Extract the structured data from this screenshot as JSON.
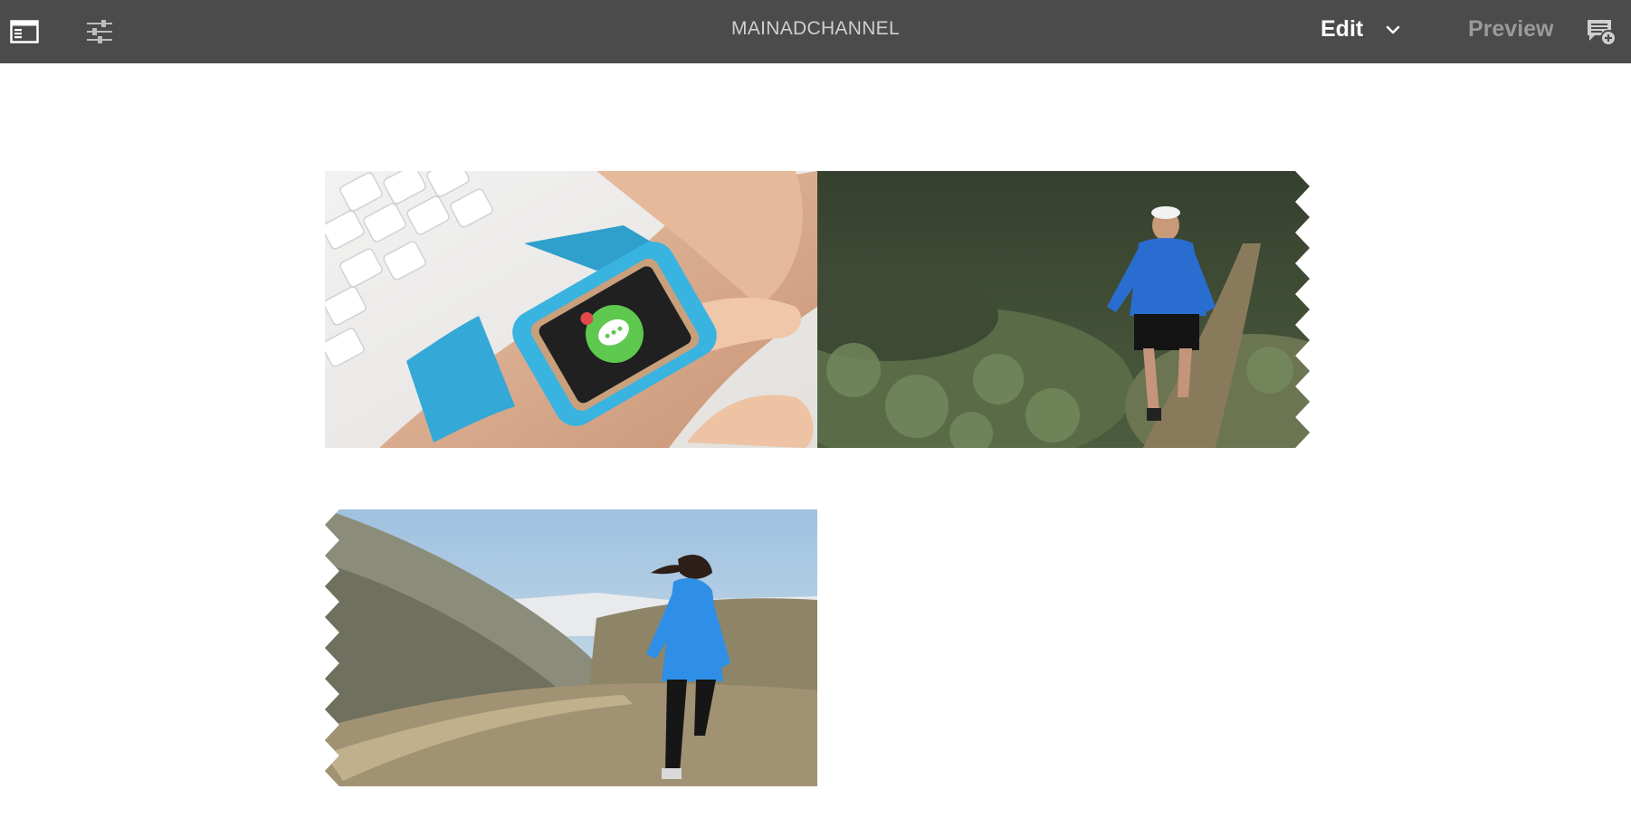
{
  "header": {
    "title": "MAINADCHANNEL",
    "mode_label": "Edit",
    "preview_label": "Preview"
  },
  "icons": {
    "sidebar_toggle": "sidebar-toggle-icon",
    "properties": "sliders-icon",
    "mode_dropdown": "chevron-down-icon",
    "annotate": "annotation-add-icon"
  },
  "colors": {
    "toolbar_bg": "#4b4b4b",
    "title_text": "#cfcfcf",
    "preview_text": "#9a9a9a",
    "canvas_bg": "#ffffff"
  },
  "channel_items": [
    {
      "type": "image",
      "subject": "smartwatch-on-wrist"
    },
    {
      "type": "image",
      "subject": "man-trail-running"
    },
    {
      "type": "image",
      "subject": "woman-running-hills"
    }
  ]
}
